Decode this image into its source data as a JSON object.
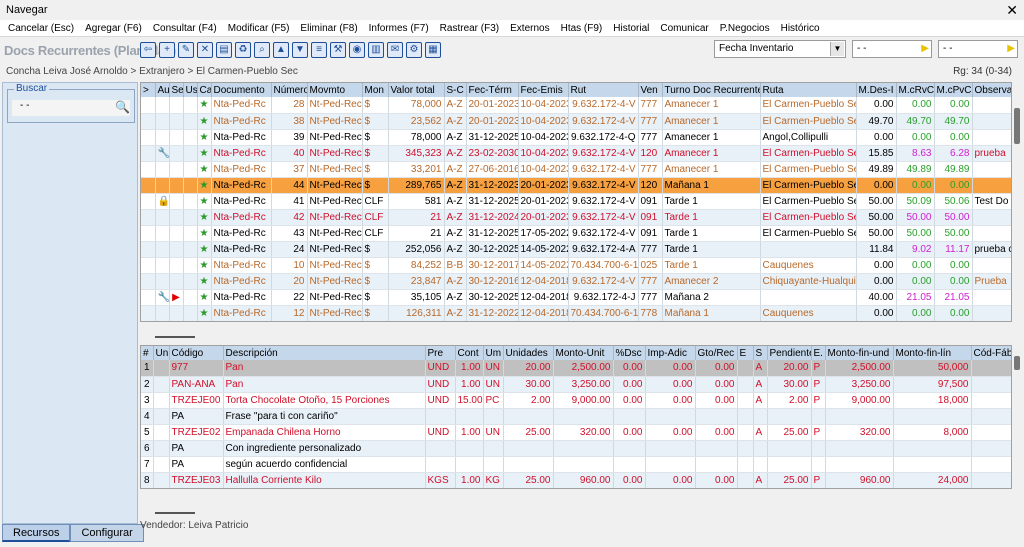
{
  "window": {
    "title": "Navegar",
    "close": "✕"
  },
  "menu": [
    "Cancelar (Esc)",
    "Agregar (F6)",
    "Consultar (F4)",
    "Modificar (F5)",
    "Eliminar (F8)",
    "Informes (F7)",
    "Rastrear (F3)",
    "Externos",
    "Htas (F9)",
    "Historial",
    "Comunicar",
    "P.Negocios",
    "Histórico"
  ],
  "toolbar": {
    "doc_title": "Docs Recurrentes (Plantillas)",
    "icons": [
      "back-icon",
      "add-icon",
      "edit-icon",
      "delete-icon",
      "book-icon",
      "trash-icon",
      "search-icon",
      "up-icon",
      "down-icon",
      "list-icon",
      "tools-icon",
      "eye-icon",
      "filter-icon",
      "comment-icon",
      "settings-icon",
      "clipboard-icon"
    ],
    "combo1": "Fecha Inventario",
    "combo2": "- -",
    "combo3": "- -"
  },
  "breadcrumb": "Concha Leiva José Arnoldo > Extranjero > El Carmen-Pueblo Sec",
  "rg_count": "Rg: 34 (0-34)",
  "left_panel": {
    "buscar_label": "Buscar",
    "buscar_value": "- -"
  },
  "tabs": {
    "recursos": "Recursos",
    "configurar": "Configurar"
  },
  "vendedor": "Vendedor: Leiva Patricio",
  "top_grid": {
    "headers": [
      ">",
      "Au",
      "Se",
      "Us",
      "Ca",
      "Documento",
      "Número",
      "Movmto",
      "Mon",
      "Valor total",
      "S-C",
      "Fec-Térm",
      "Fec-Emis",
      "Rut",
      "Ven",
      "Turno Doc Recurrente",
      "Ruta",
      "M.Des-I",
      "M.cRvC",
      "M.cPvC",
      "Observa"
    ],
    "rows": [
      {
        "style": "brown",
        "au": "",
        "star": "★",
        "doc": "Nta-Ped-Rc",
        "num": "28",
        "mov": "Nt-Ped-Rec",
        "mon": "$",
        "val": "78,000",
        "sc": "A-Z",
        "ft": "20-01-2023",
        "fe": "10-04-2023",
        "rut": "9.632.172-4-V",
        "ven": "777",
        "turno": "Amanecer 1",
        "ruta": "El Carmen-Pueblo Sec",
        "md": "0.00",
        "mr": "0.00",
        "mp": "0.00",
        "obs": ""
      },
      {
        "style": "brown",
        "au": "",
        "star": "★",
        "doc": "Nta-Ped-Rc",
        "num": "38",
        "mov": "Nt-Ped-Rec",
        "mon": "$",
        "val": "23,562",
        "sc": "A-Z",
        "ft": "20-01-2023",
        "fe": "10-04-2023",
        "rut": "9.632.172-4-V",
        "ven": "777",
        "turno": "Amanecer 1",
        "ruta": "El Carmen-Pueblo Sec",
        "md": "49.70",
        "mr": "49.70",
        "mp": "49.70",
        "obs": ""
      },
      {
        "style": "black",
        "au": "",
        "star": "★",
        "doc": "Nta-Ped-Rc",
        "num": "39",
        "mov": "Nt-Ped-Rec",
        "mon": "$",
        "val": "78,000",
        "sc": "A-Z",
        "ft": "31-12-2025",
        "fe": "10-04-2023",
        "rut": "9.632.172-4-Q",
        "ven": "777",
        "turno": "Amanecer 1",
        "ruta": "Angol,Collipulli",
        "md": "0.00",
        "mr": "0.00",
        "mp": "0.00",
        "obs": ""
      },
      {
        "style": "red",
        "au": "🔧",
        "star": "★",
        "doc": "Nta-Ped-Rc",
        "num": "40",
        "mov": "Nt-Ped-Rec",
        "mon": "$",
        "val": "345,323",
        "sc": "A-Z",
        "ft": "23-02-2030",
        "fe": "10-04-2023",
        "rut": "9.632.172-4-V",
        "ven": "120",
        "turno": "Amanecer 1",
        "ruta": "El Carmen-Pueblo Sec",
        "md": "15.85",
        "mr": "8.63",
        "mp": "6.28",
        "obs": "prueba"
      },
      {
        "style": "brown",
        "au": "",
        "star": "★",
        "doc": "Nta-Ped-Rc",
        "num": "37",
        "mov": "Nt-Ped-Rec",
        "mon": "$",
        "val": "33,201",
        "sc": "A-Z",
        "ft": "27-06-2016",
        "fe": "10-04-2023",
        "rut": "9.632.172-4-V",
        "ven": "777",
        "turno": "Amanecer 1",
        "ruta": "El Carmen-Pueblo Sec",
        "md": "49.89",
        "mr": "49.89",
        "mp": "49.89",
        "obs": ""
      },
      {
        "style": "sel",
        "au": "",
        "star": "★",
        "doc": "Nta-Ped-Rc",
        "num": "44",
        "mov": "Nt-Ped-Rec",
        "mon": "$",
        "val": "289,765",
        "sc": "A-Z",
        "ft": "31-12-2023",
        "fe": "20-01-2023",
        "rut": "9.632.172-4-V",
        "ven": "120",
        "turno": "Mañana 1",
        "ruta": "El Carmen-Pueblo Sec",
        "md": "0.00",
        "mr": "0.00",
        "mp": "0.00",
        "obs": ""
      },
      {
        "style": "black",
        "au": "🔒",
        "star": "★",
        "doc": "Nta-Ped-Rc",
        "num": "41",
        "mov": "Nt-Ped-Rec",
        "mon": "CLF",
        "val": "581",
        "sc": "A-Z",
        "ft": "31-12-2025",
        "fe": "20-01-2023",
        "rut": "9.632.172-4-V",
        "ven": "091",
        "turno": "Tarde 1",
        "ruta": "El Carmen-Pueblo Sec",
        "md": "50.00",
        "mr": "50.09",
        "mp": "50.06",
        "obs": "Test Do"
      },
      {
        "style": "red",
        "au": "",
        "star": "★",
        "doc": "Nta-Ped-Rc",
        "num": "42",
        "mov": "Nt-Ped-Rec",
        "mon": "CLF",
        "val": "21",
        "sc": "A-Z",
        "ft": "31-12-2024",
        "fe": "20-01-2023",
        "rut": "9.632.172-4-V",
        "ven": "091",
        "turno": "Tarde 1",
        "ruta": "El Carmen-Pueblo Sec",
        "md": "50.00",
        "mr": "50.00",
        "mp": "50.00",
        "obs": ""
      },
      {
        "style": "black",
        "au": "",
        "star": "★",
        "doc": "Nta-Ped-Rc",
        "num": "43",
        "mov": "Nt-Ped-Rec",
        "mon": "CLF",
        "val": "21",
        "sc": "A-Z",
        "ft": "31-12-2025",
        "fe": "17-05-2022",
        "rut": "9.632.172-4-V",
        "ven": "091",
        "turno": "Tarde 1",
        "ruta": "El Carmen-Pueblo Sec",
        "md": "50.00",
        "mr": "50.00",
        "mp": "50.00",
        "obs": ""
      },
      {
        "style": "black",
        "au": "",
        "star": "★",
        "doc": "Nta-Ped-Rc",
        "num": "24",
        "mov": "Nt-Ped-Rec",
        "mon": "$",
        "val": "252,056",
        "sc": "A-Z",
        "ft": "30-12-2025",
        "fe": "14-05-2022",
        "rut": "9.632.172-4-A",
        "ven": "777",
        "turno": "Tarde 1",
        "ruta": "",
        "md": "11.84",
        "mr": "9.02",
        "mp": "11.17",
        "obs": "prueba c"
      },
      {
        "style": "brown",
        "au": "",
        "star": "★",
        "doc": "Nta-Ped-Rc",
        "num": "10",
        "mov": "Nt-Ped-Rec",
        "mon": "$",
        "val": "84,252",
        "sc": "B-B",
        "ft": "30-12-2017",
        "fe": "14-05-2022",
        "rut": "70.434.700-6-1",
        "ven": "025",
        "turno": "Tarde 1",
        "ruta": "Cauquenes",
        "md": "0.00",
        "mr": "0.00",
        "mp": "0.00",
        "obs": ""
      },
      {
        "style": "brown",
        "au": "",
        "star": "★",
        "doc": "Nta-Ped-Rc",
        "num": "20",
        "mov": "Nt-Ped-Rec",
        "mon": "$",
        "val": "23,847",
        "sc": "A-Z",
        "ft": "30-12-2016",
        "fe": "12-04-2018",
        "rut": "9.632.172-4-V",
        "ven": "777",
        "turno": "Amanecer 2",
        "ruta": "Chiquayante-Hualqui",
        "md": "0.00",
        "mr": "0.00",
        "mp": "0.00",
        "obs": "Prueba"
      },
      {
        "style": "black",
        "au": "🔧",
        "flag": "▶",
        "star": "★",
        "doc": "Nta-Ped-Rc",
        "num": "22",
        "mov": "Nt-Ped-Rec",
        "mon": "$",
        "val": "35,105",
        "sc": "A-Z",
        "ft": "30-12-2025",
        "fe": "12-04-2018",
        "rut": "9.632.172-4-J",
        "ven": "777",
        "turno": "Mañana 2",
        "ruta": "",
        "md": "40.00",
        "mr": "21.05",
        "mp": "21.05",
        "obs": ""
      },
      {
        "style": "brown",
        "au": "",
        "star": "★",
        "doc": "Nta-Ped-Rc",
        "num": "12",
        "mov": "Nt-Ped-Rec",
        "mon": "$",
        "val": "126,311",
        "sc": "A-Z",
        "ft": "31-12-2022",
        "fe": "12-04-2018",
        "rut": "70.434.700-6-1",
        "ven": "778",
        "turno": "Mañana 1",
        "ruta": "Cauquenes",
        "md": "0.00",
        "mr": "0.00",
        "mp": "0.00",
        "obs": ""
      }
    ]
  },
  "bottom_grid": {
    "headers": [
      "#",
      "Un",
      "Código",
      "Descripción",
      "Pre",
      "Cont",
      "Um",
      "Unidades",
      "Monto-Unit",
      "%Dsc",
      "Imp-Adic",
      "Gto/Rec",
      "E",
      "S",
      "Pendiente",
      "E.",
      "Monto-fin-und",
      "Monto-fin-lín",
      "Cód-Fábrica"
    ],
    "rows": [
      {
        "n": "1",
        "cod": "977",
        "desc": "Pan",
        "pre": "UND",
        "cont": "1.00",
        "um": "UN",
        "uni": "20.00",
        "mu": "2,500.00",
        "dsc": "0.00",
        "imp": "0.00",
        "gto": "0.00",
        "e": "",
        "s": "A",
        "pend": "20.00",
        "e2": "P",
        "mfu": "2,500.00",
        "mfl": "50,000",
        "style": "red"
      },
      {
        "n": "2",
        "cod": "PAN-ANA",
        "desc": "Pan",
        "pre": "UND",
        "cont": "1.00",
        "um": "UN",
        "uni": "30.00",
        "mu": "3,250.00",
        "dsc": "0.00",
        "imp": "0.00",
        "gto": "0.00",
        "e": "",
        "s": "A",
        "pend": "30.00",
        "e2": "P",
        "mfu": "3,250.00",
        "mfl": "97,500",
        "style": "red"
      },
      {
        "n": "3",
        "cod": "TRZEJE00",
        "desc": "Torta Chocolate Otoño, 15 Porciones",
        "pre": "UND",
        "cont": "15.00",
        "um": "PC",
        "uni": "2.00",
        "mu": "9,000.00",
        "dsc": "0.00",
        "imp": "0.00",
        "gto": "0.00",
        "e": "",
        "s": "A",
        "pend": "2.00",
        "e2": "P",
        "mfu": "9,000.00",
        "mfl": "18,000",
        "style": "red"
      },
      {
        "n": "4",
        "cod": "PA",
        "desc": "Frase \"para ti con cariño\"",
        "pre": "",
        "cont": "",
        "um": "",
        "uni": "",
        "mu": "",
        "dsc": "",
        "imp": "",
        "gto": "",
        "e": "",
        "s": "",
        "pend": "",
        "e2": "",
        "mfu": "",
        "mfl": "",
        "style": "black"
      },
      {
        "n": "5",
        "cod": "TRZEJE02",
        "desc": "Empanada Chilena Horno",
        "pre": "UND",
        "cont": "1.00",
        "um": "UN",
        "uni": "25.00",
        "mu": "320.00",
        "dsc": "0.00",
        "imp": "0.00",
        "gto": "0.00",
        "e": "",
        "s": "A",
        "pend": "25.00",
        "e2": "P",
        "mfu": "320.00",
        "mfl": "8,000",
        "style": "red"
      },
      {
        "n": "6",
        "cod": "PA",
        "desc": "Con ingrediente personalizado",
        "pre": "",
        "cont": "",
        "um": "",
        "uni": "",
        "mu": "",
        "dsc": "",
        "imp": "",
        "gto": "",
        "e": "",
        "s": "",
        "pend": "",
        "e2": "",
        "mfu": "",
        "mfl": "",
        "style": "black"
      },
      {
        "n": "7",
        "cod": "PA",
        "desc": "según acuerdo confidencial",
        "pre": "",
        "cont": "",
        "um": "",
        "uni": "",
        "mu": "",
        "dsc": "",
        "imp": "",
        "gto": "",
        "e": "",
        "s": "",
        "pend": "",
        "e2": "",
        "mfu": "",
        "mfl": "",
        "style": "black"
      },
      {
        "n": "8",
        "cod": "TRZEJE03",
        "desc": "Hallulla Corriente Kilo",
        "pre": "KGS",
        "cont": "1.00",
        "um": "KG",
        "uni": "25.00",
        "mu": "960.00",
        "dsc": "0.00",
        "imp": "0.00",
        "gto": "0.00",
        "e": "",
        "s": "A",
        "pend": "25.00",
        "e2": "P",
        "mfu": "960.00",
        "mfl": "24,000",
        "style": "red"
      }
    ]
  }
}
